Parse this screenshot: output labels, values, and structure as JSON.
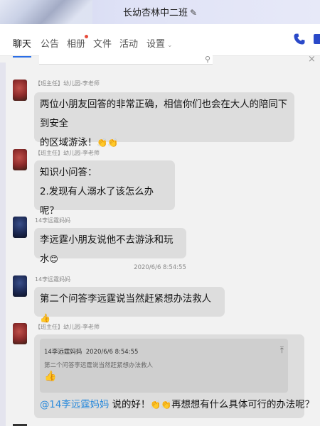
{
  "window": {
    "title": "长幼杏林中二班",
    "edit_icon": "pencil-icon"
  },
  "tabs": [
    {
      "label": "聊天",
      "active": true
    },
    {
      "label": "公告"
    },
    {
      "label": "相册",
      "badge": true
    },
    {
      "label": "文件"
    },
    {
      "label": "活动"
    },
    {
      "label": "设置"
    }
  ],
  "colors": {
    "accent": "#2a6ee6",
    "mention": "#2a8adb",
    "bubble": "#dddddd",
    "badge": "#e74c3c"
  },
  "messages": [
    {
      "sender": "【班主任】幼儿园-李老师",
      "lines": [
        "两位小朋友回答的非常正确，相信你们也会在大人的陪同下到安全",
        "的区域游泳！"
      ],
      "emoji": "👏👏"
    },
    {
      "sender": "【班主任】幼儿园-李老师",
      "lines": [
        "知识小问答：",
        "2.发现有人溺水了该怎么办呢？"
      ]
    },
    {
      "sender": "14李远霆妈妈",
      "lines": [
        "李远霆小朋友说他不去游泳和玩水"
      ],
      "emoji": "😊"
    },
    {
      "timestamp": "2020/6/6 8:54:55",
      "sender": "14李远霆妈妈",
      "lines": [
        "第二个问答李远霆说当然赶紧想办法救人"
      ],
      "emoji": "👍"
    },
    {
      "sender": "【班主任】幼儿园-李老师",
      "quote": {
        "author": "14李远霆妈妈",
        "time": "2020/6/6 8:54:55",
        "text": "第二个问答李远霆说当然赶紧想办法救人",
        "emoji": "👍"
      },
      "mention": "@14李远霆妈妈",
      "reply_a": " 说的好！",
      "reply_emoji": "👏👏",
      "reply_b": "再想想有什么具体可行的办法呢？"
    }
  ]
}
